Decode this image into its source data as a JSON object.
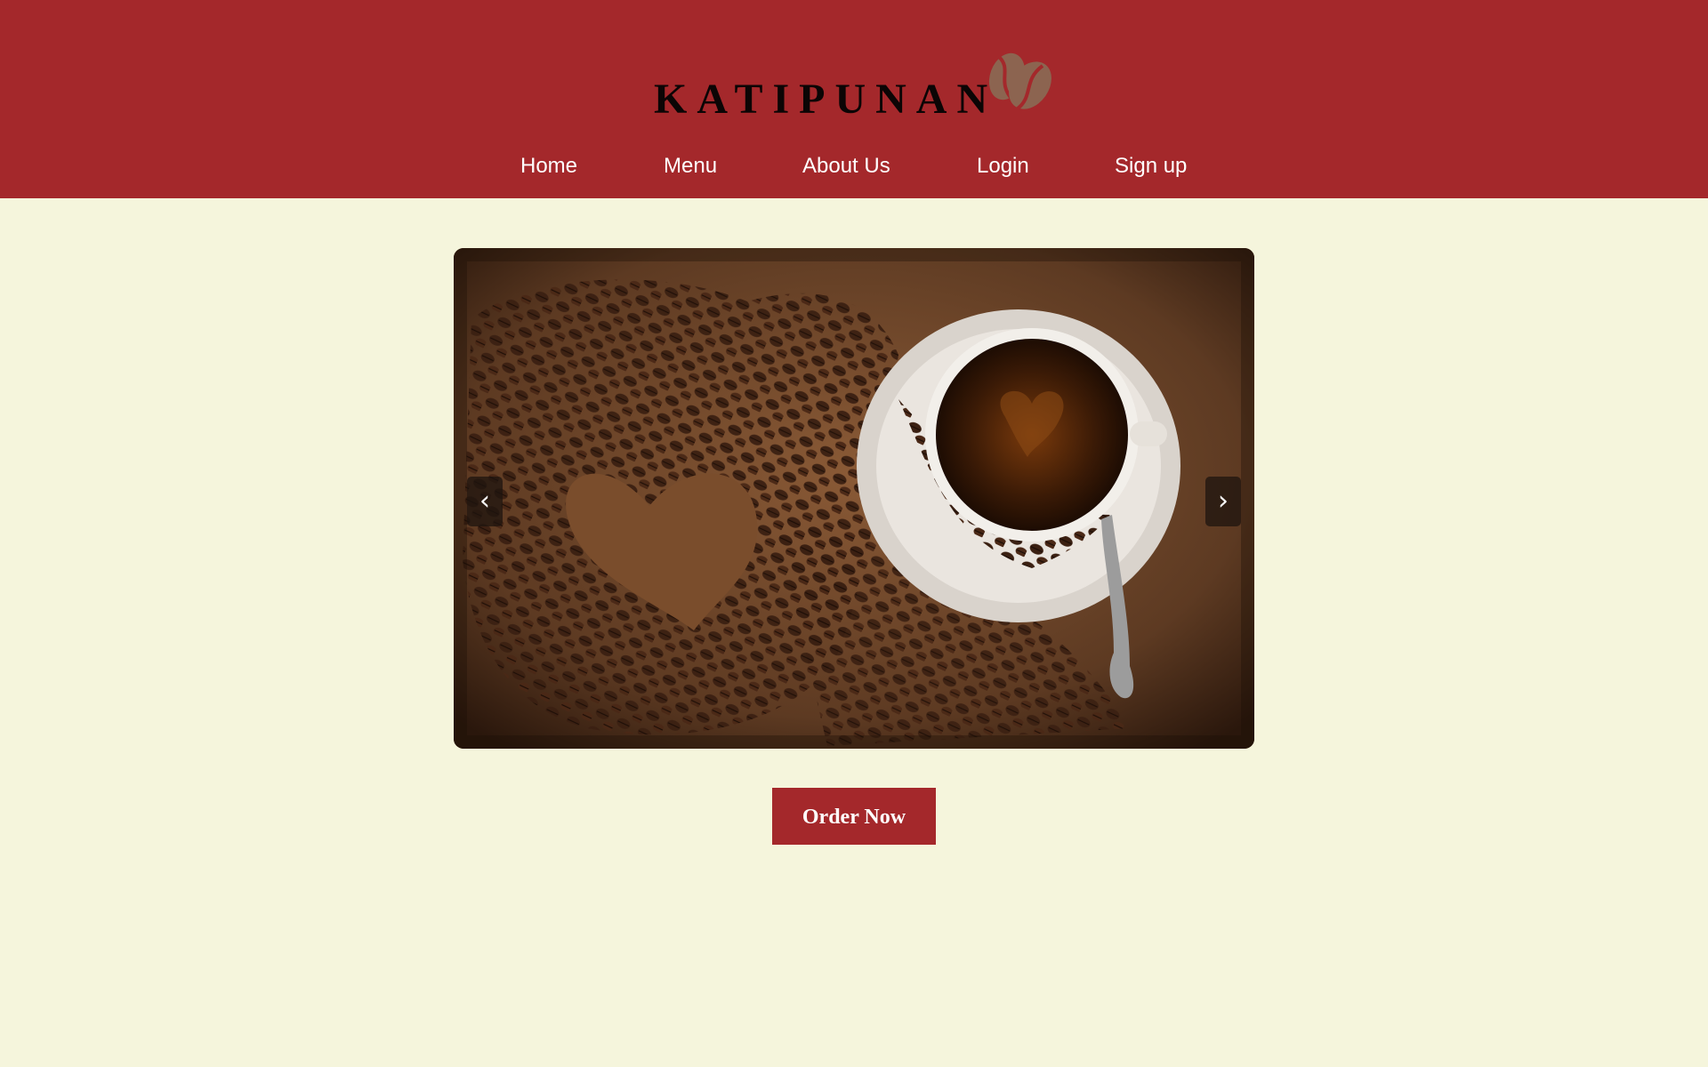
{
  "brand": {
    "name": "KATIPUNAN",
    "logo_icon": "coffee-bean-icon"
  },
  "nav": {
    "items": [
      {
        "label": "Home"
      },
      {
        "label": "Menu"
      },
      {
        "label": "About Us"
      },
      {
        "label": "Login"
      },
      {
        "label": "Sign up"
      }
    ]
  },
  "carousel": {
    "prev_label": "‹",
    "next_label": "›",
    "slide_description_icon": "coffee-cup-with-beans-heart-image"
  },
  "cta": {
    "label": "Order Now"
  },
  "colors": {
    "header_bg": "#a4282b",
    "page_bg": "#f5f5dc",
    "button_bg": "#a4282b",
    "logo_bean": "#8c6450"
  }
}
